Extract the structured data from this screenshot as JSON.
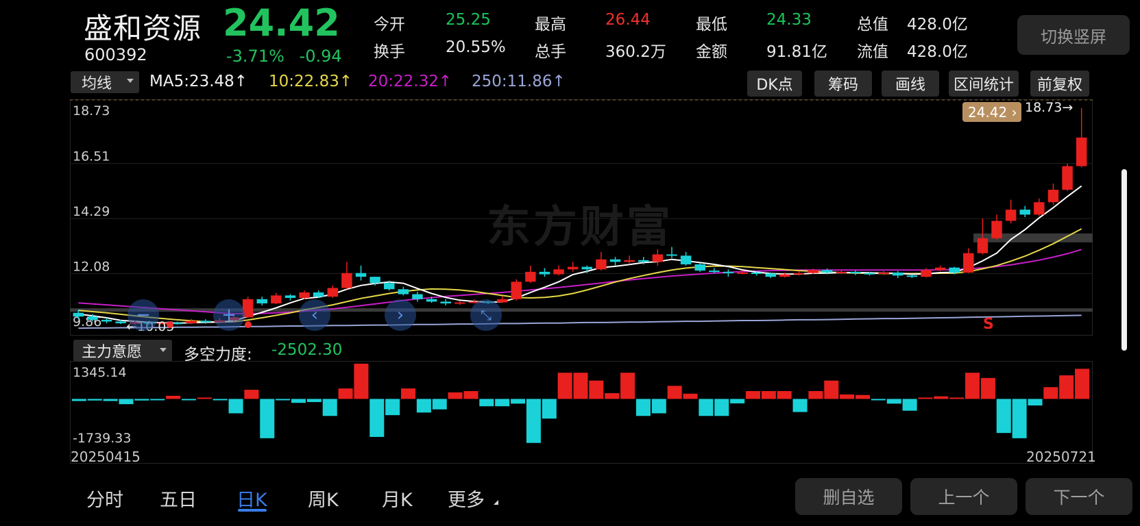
{
  "header": {
    "name": "盛和资源",
    "price": "24.42",
    "code": "600392",
    "change_pct": "-3.71%",
    "change_amt": "-0.94",
    "stats": [
      {
        "label": "今开",
        "value": "25.25",
        "color": "green"
      },
      {
        "label": "最高",
        "value": "26.44",
        "color": "red"
      },
      {
        "label": "最低",
        "value": "24.33",
        "color": "green"
      },
      {
        "label": "总值",
        "value": "428.0亿",
        "color": "white"
      },
      {
        "label": "换手",
        "value": "20.55%",
        "color": "white"
      },
      {
        "label": "总手",
        "value": "360.2万",
        "color": "white"
      },
      {
        "label": "金额",
        "value": "91.81亿",
        "color": "white"
      },
      {
        "label": "流值",
        "value": "428.0亿",
        "color": "white"
      }
    ],
    "switch_label": "切换竖屏"
  },
  "ma_bar": {
    "select_label": "均线",
    "ma5": "MA5:23.48↑",
    "ma10": "10:22.83↑",
    "ma20": "20:22.32↑",
    "ma250": "250:11.86↑",
    "buttons": [
      "DK点",
      "筹码",
      "画线",
      "区间统计",
      "前复权"
    ],
    "colors": {
      "ma5": "#ffffff",
      "ma10": "#e6d84a",
      "ma20": "#c81ec8",
      "ma250": "#9aa6d8"
    }
  },
  "chart_data": [
    {
      "type": "candlestick",
      "ylim": [
        9.86,
        18.73
      ],
      "y_ticks": [
        "18.73",
        "16.51",
        "14.29",
        "12.08",
        "9.86"
      ],
      "watermark": "东方财富",
      "last_price_tag": "24.42",
      "high_marker": "18.73→",
      "low_marker": "←10.05",
      "signal_marker": "S",
      "candles": [
        {
          "o": 10.5,
          "c": 10.35,
          "h": 10.62,
          "l": 10.25
        },
        {
          "o": 10.35,
          "c": 10.22,
          "h": 10.45,
          "l": 10.15
        },
        {
          "o": 10.22,
          "c": 10.15,
          "h": 10.3,
          "l": 10.08
        },
        {
          "o": 10.15,
          "c": 10.08,
          "h": 10.22,
          "l": 10.05
        },
        {
          "o": 10.08,
          "c": 10.12,
          "h": 10.2,
          "l": 10.02
        },
        {
          "o": 10.12,
          "c": 10.06,
          "h": 10.18,
          "l": 10.0
        },
        {
          "o": 10.06,
          "c": 10.1,
          "h": 10.16,
          "l": 10.02
        },
        {
          "o": 10.1,
          "c": 10.08,
          "h": 10.15,
          "l": 10.03
        },
        {
          "o": 10.08,
          "c": 10.18,
          "h": 10.25,
          "l": 10.05
        },
        {
          "o": 10.18,
          "c": 10.12,
          "h": 10.24,
          "l": 10.06
        },
        {
          "o": 10.12,
          "c": 10.2,
          "h": 10.3,
          "l": 10.08
        },
        {
          "o": 10.2,
          "c": 10.32,
          "h": 10.45,
          "l": 10.15
        },
        {
          "o": 10.32,
          "c": 11.05,
          "h": 11.15,
          "l": 10.3
        },
        {
          "o": 11.05,
          "c": 10.88,
          "h": 11.15,
          "l": 10.8
        },
        {
          "o": 10.88,
          "c": 11.2,
          "h": 11.3,
          "l": 10.85
        },
        {
          "o": 11.2,
          "c": 11.1,
          "h": 11.25,
          "l": 11.0
        },
        {
          "o": 11.1,
          "c": 11.32,
          "h": 11.4,
          "l": 11.05
        },
        {
          "o": 11.32,
          "c": 11.15,
          "h": 11.4,
          "l": 11.1
        },
        {
          "o": 11.15,
          "c": 11.5,
          "h": 11.6,
          "l": 11.1
        },
        {
          "o": 11.5,
          "c": 12.1,
          "h": 12.55,
          "l": 11.45
        },
        {
          "o": 12.1,
          "c": 11.95,
          "h": 12.4,
          "l": 11.8
        },
        {
          "o": 11.95,
          "c": 11.7,
          "h": 11.95,
          "l": 11.6
        },
        {
          "o": 11.7,
          "c": 11.45,
          "h": 11.8,
          "l": 11.4
        },
        {
          "o": 11.45,
          "c": 11.25,
          "h": 11.55,
          "l": 11.2
        },
        {
          "o": 11.25,
          "c": 11.05,
          "h": 11.35,
          "l": 10.95
        },
        {
          "o": 11.05,
          "c": 10.95,
          "h": 11.15,
          "l": 10.9
        },
        {
          "o": 10.95,
          "c": 10.88,
          "h": 11.05,
          "l": 10.8
        },
        {
          "o": 10.88,
          "c": 10.92,
          "h": 10.98,
          "l": 10.82
        },
        {
          "o": 10.92,
          "c": 10.95,
          "h": 11.05,
          "l": 10.88
        },
        {
          "o": 10.95,
          "c": 10.92,
          "h": 11.0,
          "l": 10.85
        },
        {
          "o": 10.92,
          "c": 11.05,
          "h": 11.18,
          "l": 10.9
        },
        {
          "o": 11.05,
          "c": 11.75,
          "h": 11.85,
          "l": 11.0
        },
        {
          "o": 11.75,
          "c": 12.15,
          "h": 12.4,
          "l": 11.7
        },
        {
          "o": 12.15,
          "c": 12.05,
          "h": 12.3,
          "l": 11.95
        },
        {
          "o": 12.05,
          "c": 12.25,
          "h": 12.4,
          "l": 12.0
        },
        {
          "o": 12.25,
          "c": 12.35,
          "h": 12.55,
          "l": 12.15
        },
        {
          "o": 12.35,
          "c": 12.25,
          "h": 12.4,
          "l": 12.1
        },
        {
          "o": 12.25,
          "c": 12.65,
          "h": 12.95,
          "l": 12.2
        },
        {
          "o": 12.65,
          "c": 12.55,
          "h": 12.75,
          "l": 12.4
        },
        {
          "o": 12.55,
          "c": 12.62,
          "h": 12.8,
          "l": 12.45
        },
        {
          "o": 12.62,
          "c": 12.55,
          "h": 12.75,
          "l": 12.45
        },
        {
          "o": 12.55,
          "c": 12.85,
          "h": 13.05,
          "l": 12.4
        },
        {
          "o": 12.85,
          "c": 12.8,
          "h": 13.15,
          "l": 12.7
        },
        {
          "o": 12.8,
          "c": 12.45,
          "h": 12.95,
          "l": 12.4
        },
        {
          "o": 12.45,
          "c": 12.2,
          "h": 12.5,
          "l": 12.15
        },
        {
          "o": 12.2,
          "c": 12.15,
          "h": 12.3,
          "l": 12.1
        },
        {
          "o": 12.15,
          "c": 12.1,
          "h": 12.25,
          "l": 11.95
        },
        {
          "o": 12.1,
          "c": 12.12,
          "h": 12.2,
          "l": 12.05
        },
        {
          "o": 12.12,
          "c": 12.08,
          "h": 12.18,
          "l": 12.0
        },
        {
          "o": 12.08,
          "c": 11.95,
          "h": 12.12,
          "l": 11.9
        },
        {
          "o": 11.95,
          "c": 12.05,
          "h": 12.12,
          "l": 11.92
        },
        {
          "o": 12.05,
          "c": 12.1,
          "h": 12.18,
          "l": 12.0
        },
        {
          "o": 12.1,
          "c": 12.22,
          "h": 12.28,
          "l": 12.05
        },
        {
          "o": 12.22,
          "c": 12.12,
          "h": 12.28,
          "l": 12.05
        },
        {
          "o": 12.12,
          "c": 12.15,
          "h": 12.22,
          "l": 12.05
        },
        {
          "o": 12.15,
          "c": 12.1,
          "h": 12.2,
          "l": 12.02
        },
        {
          "o": 12.1,
          "c": 12.08,
          "h": 12.15,
          "l": 12.0
        },
        {
          "o": 12.08,
          "c": 12.12,
          "h": 12.18,
          "l": 12.02
        },
        {
          "o": 12.12,
          "c": 12.0,
          "h": 12.18,
          "l": 11.9
        },
        {
          "o": 12.0,
          "c": 11.95,
          "h": 12.05,
          "l": 11.9
        },
        {
          "o": 11.95,
          "c": 12.22,
          "h": 12.3,
          "l": 11.92
        },
        {
          "o": 12.22,
          "c": 12.32,
          "h": 12.4,
          "l": 12.18
        },
        {
          "o": 12.32,
          "c": 12.12,
          "h": 12.35,
          "l": 12.05
        },
        {
          "o": 12.12,
          "c": 12.9,
          "h": 13.1,
          "l": 12.1
        },
        {
          "o": 12.9,
          "c": 13.5,
          "h": 14.3,
          "l": 12.85
        },
        {
          "o": 13.5,
          "c": 14.2,
          "h": 14.45,
          "l": 13.45
        },
        {
          "o": 14.2,
          "c": 14.65,
          "h": 15.05,
          "l": 14.1
        },
        {
          "o": 14.65,
          "c": 14.45,
          "h": 14.8,
          "l": 14.35
        },
        {
          "o": 14.45,
          "c": 14.95,
          "h": 15.1,
          "l": 14.4
        },
        {
          "o": 14.95,
          "c": 15.45,
          "h": 15.7,
          "l": 14.85
        },
        {
          "o": 15.45,
          "c": 16.4,
          "h": 16.5,
          "l": 15.4
        },
        {
          "o": 16.4,
          "c": 17.55,
          "h": 18.73,
          "l": 16.35
        }
      ],
      "ma5": [
        10.45,
        10.38,
        10.3,
        10.2,
        10.16,
        10.12,
        10.1,
        10.09,
        10.1,
        10.12,
        10.13,
        10.18,
        10.35,
        10.52,
        10.7,
        10.9,
        11.08,
        11.13,
        11.25,
        11.45,
        11.6,
        11.68,
        11.74,
        11.69,
        11.48,
        11.28,
        11.12,
        11.01,
        10.96,
        10.93,
        10.94,
        11.1,
        11.32,
        11.53,
        11.75,
        12.04,
        12.17,
        12.32,
        12.37,
        12.44,
        12.52,
        12.56,
        12.65,
        12.59,
        12.52,
        12.45,
        12.36,
        12.23,
        12.14,
        12.08,
        12.06,
        12.06,
        12.09,
        12.1,
        12.12,
        12.12,
        12.11,
        12.1,
        12.09,
        12.05,
        12.07,
        12.12,
        12.13,
        12.32,
        12.59,
        12.9,
        13.45,
        13.85,
        14.32,
        14.73,
        15.18,
        15.6
      ],
      "ma10": [
        10.6,
        10.55,
        10.5,
        10.44,
        10.38,
        10.32,
        10.27,
        10.22,
        10.18,
        10.15,
        10.13,
        10.14,
        10.21,
        10.3,
        10.4,
        10.5,
        10.62,
        10.72,
        10.82,
        10.95,
        11.08,
        11.18,
        11.28,
        11.36,
        11.42,
        11.46,
        11.45,
        11.42,
        11.36,
        11.28,
        11.2,
        11.12,
        11.1,
        11.12,
        11.18,
        11.28,
        11.42,
        11.58,
        11.74,
        11.88,
        12.0,
        12.12,
        12.22,
        12.3,
        12.35,
        12.38,
        12.38,
        12.36,
        12.32,
        12.28,
        12.24,
        12.2,
        12.17,
        12.14,
        12.12,
        12.1,
        12.09,
        12.08,
        12.08,
        12.08,
        12.08,
        12.09,
        12.1,
        12.16,
        12.27,
        12.4,
        12.58,
        12.78,
        13.02,
        13.28,
        13.58,
        13.88
      ],
      "ma20": [
        10.9,
        10.86,
        10.82,
        10.78,
        10.74,
        10.7,
        10.66,
        10.62,
        10.58,
        10.54,
        10.5,
        10.47,
        10.47,
        10.48,
        10.5,
        10.53,
        10.57,
        10.61,
        10.66,
        10.72,
        10.79,
        10.86,
        10.93,
        11.0,
        11.06,
        11.11,
        11.16,
        11.2,
        11.24,
        11.28,
        11.32,
        11.37,
        11.42,
        11.47,
        11.52,
        11.58,
        11.64,
        11.7,
        11.76,
        11.82,
        11.88,
        11.93,
        11.98,
        12.02,
        12.06,
        12.1,
        12.13,
        12.16,
        12.18,
        12.2,
        12.21,
        12.22,
        12.22,
        12.22,
        12.22,
        12.22,
        12.22,
        12.22,
        12.22,
        12.22,
        12.22,
        12.23,
        12.24,
        12.27,
        12.31,
        12.36,
        12.43,
        12.52,
        12.62,
        12.74,
        12.88,
        13.05
      ],
      "ma250": [
        9.88,
        9.89,
        9.89,
        9.9,
        9.9,
        9.91,
        9.91,
        9.92,
        9.92,
        9.93,
        9.93,
        9.94,
        9.95,
        9.95,
        9.96,
        9.97,
        9.97,
        9.98,
        9.99,
        9.99,
        10.0,
        10.01,
        10.01,
        10.02,
        10.03,
        10.03,
        10.04,
        10.05,
        10.05,
        10.06,
        10.07,
        10.07,
        10.08,
        10.09,
        10.09,
        10.1,
        10.11,
        10.11,
        10.12,
        10.13,
        10.13,
        10.14,
        10.15,
        10.16,
        10.16,
        10.17,
        10.18,
        10.19,
        10.19,
        10.2,
        10.21,
        10.22,
        10.22,
        10.23,
        10.24,
        10.25,
        10.26,
        10.27,
        10.27,
        10.28,
        10.29,
        10.3,
        10.31,
        10.32,
        10.33,
        10.34,
        10.35,
        10.36,
        10.37,
        10.38,
        10.39,
        10.4
      ],
      "ref_lines": [
        10.6,
        13.5
      ],
      "ref_lines_note_removed": true
    },
    {
      "type": "bar",
      "title": "主力意愿",
      "indicator_label": "多空力度:",
      "indicator_value": "-2502.30",
      "ylim": [
        -1739.33,
        1345.14
      ],
      "y_ticks": [
        "1345.14",
        "-1739.33"
      ],
      "x_start": "20250415",
      "x_end": "20250721",
      "values": [
        -80,
        -60,
        -80,
        -200,
        -60,
        -50,
        120,
        -20,
        30,
        -40,
        -550,
        350,
        -1500,
        -20,
        -150,
        -120,
        -650,
        400,
        1345,
        -1450,
        -620,
        400,
        -520,
        -400,
        250,
        300,
        -280,
        -280,
        -180,
        -1680,
        -750,
        1000,
        1000,
        700,
        220,
        1000,
        -650,
        -550,
        500,
        200,
        -650,
        -650,
        -170,
        300,
        300,
        300,
        -500,
        300,
        700,
        170,
        150,
        -50,
        -180,
        -450,
        0,
        100,
        50,
        1000,
        800,
        -1300,
        -1500,
        -250,
        450,
        900,
        1150
      ]
    }
  ],
  "tabs": {
    "items": [
      "分时",
      "五日",
      "日K",
      "周K",
      "月K",
      "更多"
    ],
    "active": "日K"
  },
  "bottom_buttons": [
    "删自选",
    "上一个",
    "下一个"
  ],
  "colors": {
    "up": "#e8201e",
    "down": "#1bd2d8",
    "accent": "#3a7be8",
    "price_green": "#22c35e"
  }
}
